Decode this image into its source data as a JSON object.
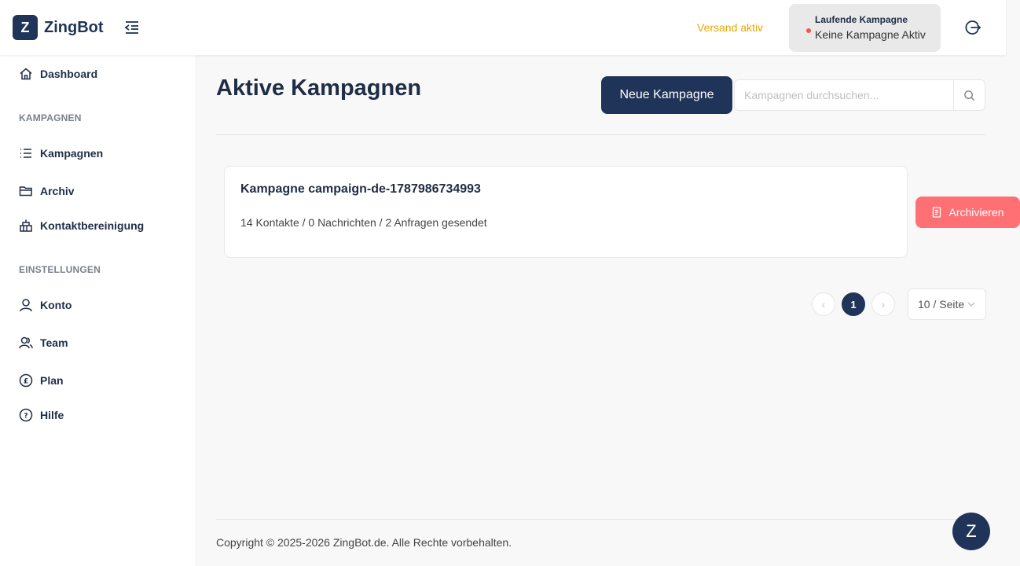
{
  "header": {
    "logo_letter": "Z",
    "app_name": "ZingBot",
    "sending_status": "Versand aktiv",
    "running_campaign": {
      "label": "Laufende Kampagne",
      "value": "Keine Kampagne Aktiv"
    }
  },
  "sidebar": {
    "dashboard": "Dashboard",
    "section_campaigns": "KAMPAGNEN",
    "campaigns": "Kampagnen",
    "archive": "Archiv",
    "contact_cleanup": "Kontaktbereinigung",
    "section_settings": "EINSTELLUNGEN",
    "account": "Konto",
    "team": "Team",
    "plan": "Plan",
    "help": "Hilfe"
  },
  "main": {
    "title": "Aktive Kampagnen",
    "new_button": "Neue Kampagne",
    "search_placeholder": "Kampagnen durchsuchen...",
    "campaign": {
      "title": "Kampagne campaign-de-1787986734993",
      "stats": "14 Kontakte / 0 Nachrichten / 2 Anfragen gesendet",
      "archive_button": "Archivieren"
    },
    "pagination": {
      "prev": "‹",
      "current_page": "1",
      "next": "›",
      "per_page": "10 / Seite"
    }
  },
  "footer": {
    "copyright": "Copyright © 2025-2026 ZingBot.de. Alle Rechte vorbehalten."
  },
  "fab_letter": "Z",
  "colors": {
    "primary": "#1f3458",
    "warning": "#e6a700",
    "danger": "#ff7075",
    "status_dot": "#ff4d4f"
  }
}
